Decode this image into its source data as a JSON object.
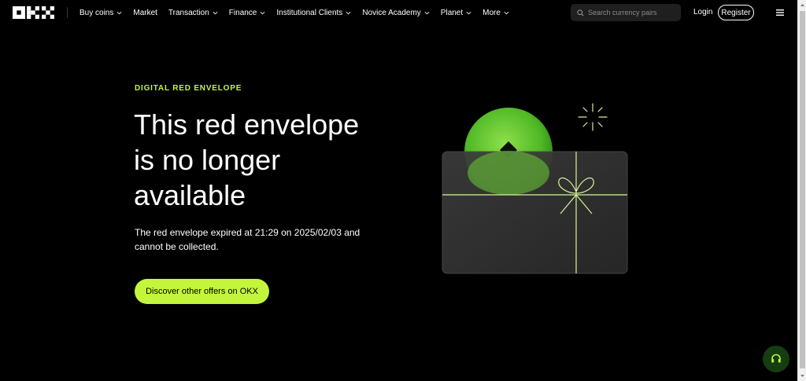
{
  "header": {
    "logo_icon": "okx-logo",
    "nav": [
      {
        "label": "Buy coins",
        "has_dropdown": true
      },
      {
        "label": "Market",
        "has_dropdown": false
      },
      {
        "label": "Transaction",
        "has_dropdown": true
      },
      {
        "label": "Finance",
        "has_dropdown": true
      },
      {
        "label": "Institutional Clients",
        "has_dropdown": true
      },
      {
        "label": "Novice Academy",
        "has_dropdown": true
      },
      {
        "label": "Planet",
        "has_dropdown": true
      },
      {
        "label": "More",
        "has_dropdown": true
      }
    ],
    "search": {
      "placeholder": "Search currency pairs",
      "value": ""
    },
    "login_label": "Login",
    "register_label": "Register",
    "menu_icon": "hamburger-icon"
  },
  "hero": {
    "eyebrow": "DIGITAL RED ENVELOPE",
    "title": "This red envelope is no longer available",
    "description": "The red envelope expired at 21:29 on 2025/02/03 and cannot be collected.",
    "cta_label": "Discover other offers on OKX"
  },
  "colors": {
    "accent": "#c3f53c",
    "background": "#000000",
    "support_bg": "#143d12"
  },
  "support_icon": "headset-icon"
}
